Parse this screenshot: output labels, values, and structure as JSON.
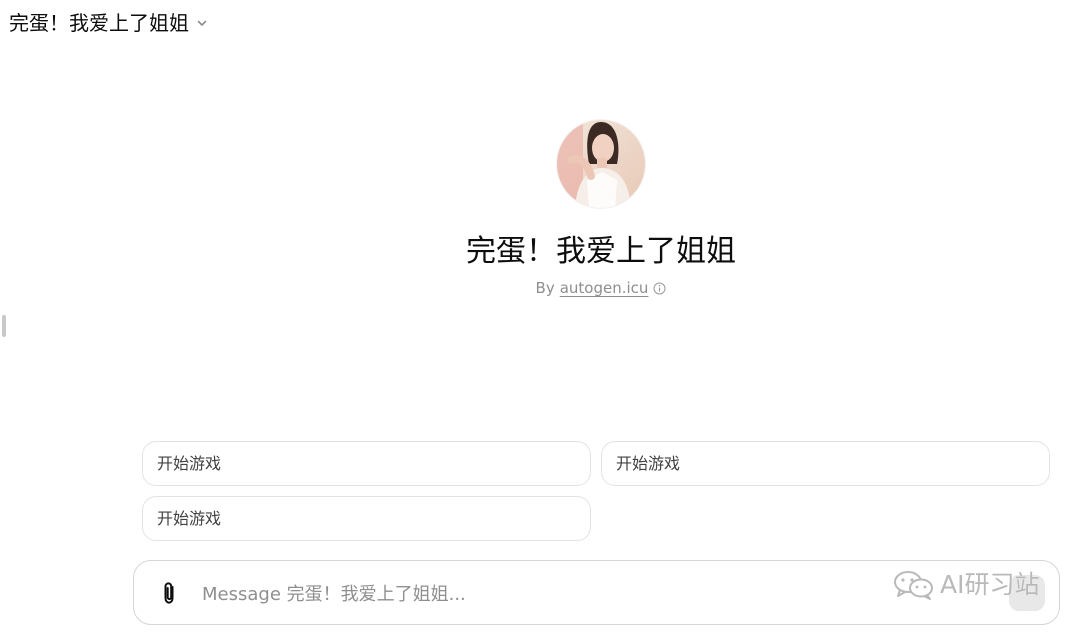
{
  "header": {
    "title": "完蛋！我爱上了姐姐",
    "chevron_icon": "chevron-down-icon"
  },
  "gpt": {
    "name": "完蛋！我爱上了姐姐",
    "by_prefix": "By",
    "author": "autogen.icu",
    "info_icon": "info-icon",
    "avatar_icon": "avatar-portrait"
  },
  "starters": [
    {
      "label": "开始游戏"
    },
    {
      "label": "开始游戏"
    },
    {
      "label": "开始游戏"
    }
  ],
  "composer": {
    "placeholder": "Message 完蛋！我爱上了姐姐...",
    "value": "",
    "attach_icon": "paperclip-icon",
    "send_icon": "send-button"
  },
  "watermark": {
    "text": "AI研习站",
    "icon": "wechat-icon"
  },
  "colors": {
    "text": "#0d0d0d",
    "muted": "#8e8e8e",
    "border": "#e3e3e3"
  }
}
